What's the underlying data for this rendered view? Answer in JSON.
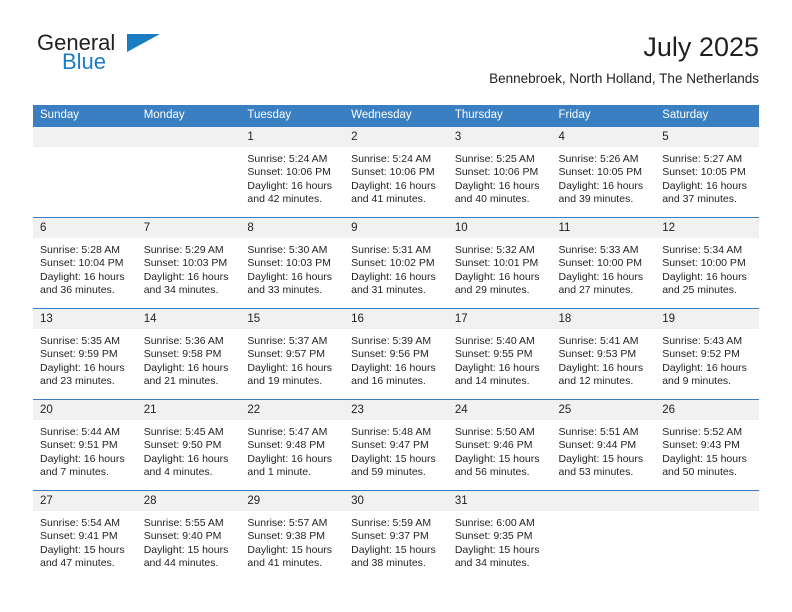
{
  "brand": {
    "name_top": "General",
    "name_bottom": "Blue",
    "triangle_color": "#1a7dc4",
    "text_color": "#231f20"
  },
  "header": {
    "title": "July 2025",
    "subtitle": "Bennebroek, North Holland, The Netherlands"
  },
  "theme": {
    "header_bg": "#3a7fc1",
    "header_text": "#ffffff",
    "daynum_bg": "#f1f1f1",
    "row_rule": "#3a7fc1",
    "body_text": "#231f20"
  },
  "weekdays": [
    "Sunday",
    "Monday",
    "Tuesday",
    "Wednesday",
    "Thursday",
    "Friday",
    "Saturday"
  ],
  "labels": {
    "sunrise_prefix": "Sunrise:",
    "sunset_prefix": "Sunset:",
    "daylight_prefix": "Daylight:"
  },
  "weeks": [
    [
      {
        "day": ""
      },
      {
        "day": ""
      },
      {
        "day": "1",
        "sunrise": "Sunrise: 5:24 AM",
        "sunset": "Sunset: 10:06 PM",
        "daylight_1": "Daylight: 16 hours",
        "daylight_2": "and 42 minutes."
      },
      {
        "day": "2",
        "sunrise": "Sunrise: 5:24 AM",
        "sunset": "Sunset: 10:06 PM",
        "daylight_1": "Daylight: 16 hours",
        "daylight_2": "and 41 minutes."
      },
      {
        "day": "3",
        "sunrise": "Sunrise: 5:25 AM",
        "sunset": "Sunset: 10:06 PM",
        "daylight_1": "Daylight: 16 hours",
        "daylight_2": "and 40 minutes."
      },
      {
        "day": "4",
        "sunrise": "Sunrise: 5:26 AM",
        "sunset": "Sunset: 10:05 PM",
        "daylight_1": "Daylight: 16 hours",
        "daylight_2": "and 39 minutes."
      },
      {
        "day": "5",
        "sunrise": "Sunrise: 5:27 AM",
        "sunset": "Sunset: 10:05 PM",
        "daylight_1": "Daylight: 16 hours",
        "daylight_2": "and 37 minutes."
      }
    ],
    [
      {
        "day": "6",
        "sunrise": "Sunrise: 5:28 AM",
        "sunset": "Sunset: 10:04 PM",
        "daylight_1": "Daylight: 16 hours",
        "daylight_2": "and 36 minutes."
      },
      {
        "day": "7",
        "sunrise": "Sunrise: 5:29 AM",
        "sunset": "Sunset: 10:03 PM",
        "daylight_1": "Daylight: 16 hours",
        "daylight_2": "and 34 minutes."
      },
      {
        "day": "8",
        "sunrise": "Sunrise: 5:30 AM",
        "sunset": "Sunset: 10:03 PM",
        "daylight_1": "Daylight: 16 hours",
        "daylight_2": "and 33 minutes."
      },
      {
        "day": "9",
        "sunrise": "Sunrise: 5:31 AM",
        "sunset": "Sunset: 10:02 PM",
        "daylight_1": "Daylight: 16 hours",
        "daylight_2": "and 31 minutes."
      },
      {
        "day": "10",
        "sunrise": "Sunrise: 5:32 AM",
        "sunset": "Sunset: 10:01 PM",
        "daylight_1": "Daylight: 16 hours",
        "daylight_2": "and 29 minutes."
      },
      {
        "day": "11",
        "sunrise": "Sunrise: 5:33 AM",
        "sunset": "Sunset: 10:00 PM",
        "daylight_1": "Daylight: 16 hours",
        "daylight_2": "and 27 minutes."
      },
      {
        "day": "12",
        "sunrise": "Sunrise: 5:34 AM",
        "sunset": "Sunset: 10:00 PM",
        "daylight_1": "Daylight: 16 hours",
        "daylight_2": "and 25 minutes."
      }
    ],
    [
      {
        "day": "13",
        "sunrise": "Sunrise: 5:35 AM",
        "sunset": "Sunset: 9:59 PM",
        "daylight_1": "Daylight: 16 hours",
        "daylight_2": "and 23 minutes."
      },
      {
        "day": "14",
        "sunrise": "Sunrise: 5:36 AM",
        "sunset": "Sunset: 9:58 PM",
        "daylight_1": "Daylight: 16 hours",
        "daylight_2": "and 21 minutes."
      },
      {
        "day": "15",
        "sunrise": "Sunrise: 5:37 AM",
        "sunset": "Sunset: 9:57 PM",
        "daylight_1": "Daylight: 16 hours",
        "daylight_2": "and 19 minutes."
      },
      {
        "day": "16",
        "sunrise": "Sunrise: 5:39 AM",
        "sunset": "Sunset: 9:56 PM",
        "daylight_1": "Daylight: 16 hours",
        "daylight_2": "and 16 minutes."
      },
      {
        "day": "17",
        "sunrise": "Sunrise: 5:40 AM",
        "sunset": "Sunset: 9:55 PM",
        "daylight_1": "Daylight: 16 hours",
        "daylight_2": "and 14 minutes."
      },
      {
        "day": "18",
        "sunrise": "Sunrise: 5:41 AM",
        "sunset": "Sunset: 9:53 PM",
        "daylight_1": "Daylight: 16 hours",
        "daylight_2": "and 12 minutes."
      },
      {
        "day": "19",
        "sunrise": "Sunrise: 5:43 AM",
        "sunset": "Sunset: 9:52 PM",
        "daylight_1": "Daylight: 16 hours",
        "daylight_2": "and 9 minutes."
      }
    ],
    [
      {
        "day": "20",
        "sunrise": "Sunrise: 5:44 AM",
        "sunset": "Sunset: 9:51 PM",
        "daylight_1": "Daylight: 16 hours",
        "daylight_2": "and 7 minutes."
      },
      {
        "day": "21",
        "sunrise": "Sunrise: 5:45 AM",
        "sunset": "Sunset: 9:50 PM",
        "daylight_1": "Daylight: 16 hours",
        "daylight_2": "and 4 minutes."
      },
      {
        "day": "22",
        "sunrise": "Sunrise: 5:47 AM",
        "sunset": "Sunset: 9:48 PM",
        "daylight_1": "Daylight: 16 hours",
        "daylight_2": "and 1 minute."
      },
      {
        "day": "23",
        "sunrise": "Sunrise: 5:48 AM",
        "sunset": "Sunset: 9:47 PM",
        "daylight_1": "Daylight: 15 hours",
        "daylight_2": "and 59 minutes."
      },
      {
        "day": "24",
        "sunrise": "Sunrise: 5:50 AM",
        "sunset": "Sunset: 9:46 PM",
        "daylight_1": "Daylight: 15 hours",
        "daylight_2": "and 56 minutes."
      },
      {
        "day": "25",
        "sunrise": "Sunrise: 5:51 AM",
        "sunset": "Sunset: 9:44 PM",
        "daylight_1": "Daylight: 15 hours",
        "daylight_2": "and 53 minutes."
      },
      {
        "day": "26",
        "sunrise": "Sunrise: 5:52 AM",
        "sunset": "Sunset: 9:43 PM",
        "daylight_1": "Daylight: 15 hours",
        "daylight_2": "and 50 minutes."
      }
    ],
    [
      {
        "day": "27",
        "sunrise": "Sunrise: 5:54 AM",
        "sunset": "Sunset: 9:41 PM",
        "daylight_1": "Daylight: 15 hours",
        "daylight_2": "and 47 minutes."
      },
      {
        "day": "28",
        "sunrise": "Sunrise: 5:55 AM",
        "sunset": "Sunset: 9:40 PM",
        "daylight_1": "Daylight: 15 hours",
        "daylight_2": "and 44 minutes."
      },
      {
        "day": "29",
        "sunrise": "Sunrise: 5:57 AM",
        "sunset": "Sunset: 9:38 PM",
        "daylight_1": "Daylight: 15 hours",
        "daylight_2": "and 41 minutes."
      },
      {
        "day": "30",
        "sunrise": "Sunrise: 5:59 AM",
        "sunset": "Sunset: 9:37 PM",
        "daylight_1": "Daylight: 15 hours",
        "daylight_2": "and 38 minutes."
      },
      {
        "day": "31",
        "sunrise": "Sunrise: 6:00 AM",
        "sunset": "Sunset: 9:35 PM",
        "daylight_1": "Daylight: 15 hours",
        "daylight_2": "and 34 minutes."
      },
      {
        "day": ""
      },
      {
        "day": ""
      }
    ]
  ]
}
